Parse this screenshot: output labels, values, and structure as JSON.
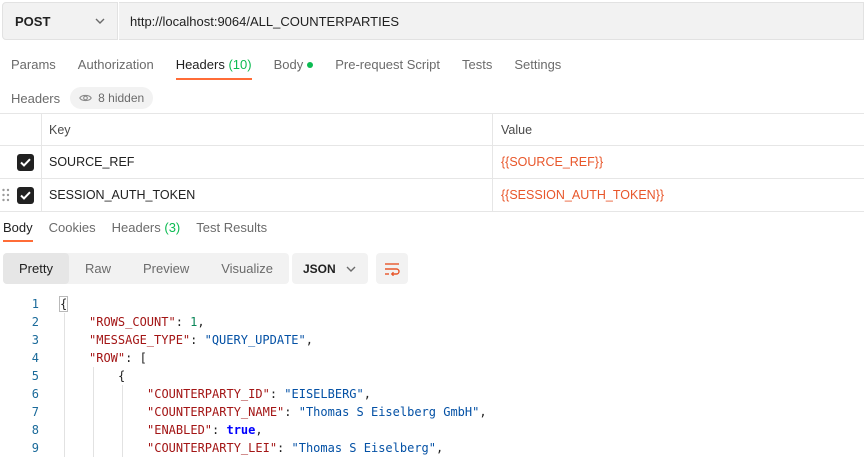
{
  "request": {
    "method": "POST",
    "url": "http://localhost:9064/ALL_COUNTERPARTIES"
  },
  "request_tabs": [
    {
      "label": "Params",
      "count": "",
      "dot": false,
      "active": false
    },
    {
      "label": "Authorization",
      "count": "",
      "dot": false,
      "active": false
    },
    {
      "label": "Headers",
      "count": "(10)",
      "dot": false,
      "active": true
    },
    {
      "label": "Body",
      "count": "",
      "dot": true,
      "active": false
    },
    {
      "label": "Pre-request Script",
      "count": "",
      "dot": false,
      "active": false
    },
    {
      "label": "Tests",
      "count": "",
      "dot": false,
      "active": false
    },
    {
      "label": "Settings",
      "count": "",
      "dot": false,
      "active": false
    }
  ],
  "headers_section": {
    "label": "Headers",
    "hidden_label": "8 hidden"
  },
  "headers_table": {
    "col_key": "Key",
    "col_value": "Value",
    "rows": [
      {
        "key": "SOURCE_REF",
        "value": "{{SOURCE_REF}}",
        "checked": true
      },
      {
        "key": "SESSION_AUTH_TOKEN",
        "value": "{{SESSION_AUTH_TOKEN}}",
        "checked": true
      }
    ]
  },
  "response_tabs": [
    {
      "label": "Body",
      "count": "",
      "active": true
    },
    {
      "label": "Cookies",
      "count": "",
      "active": false
    },
    {
      "label": "Headers",
      "count": "(3)",
      "active": false
    },
    {
      "label": "Test Results",
      "count": "",
      "active": false
    }
  ],
  "view_modes": [
    {
      "label": "Pretty",
      "active": true
    },
    {
      "label": "Raw",
      "active": false
    },
    {
      "label": "Preview",
      "active": false
    },
    {
      "label": "Visualize",
      "active": false
    }
  ],
  "format": {
    "selected": "JSON"
  },
  "code_lines": [
    {
      "num": "1",
      "indent": 0,
      "tokens": [
        {
          "t": "p",
          "v": "{"
        }
      ]
    },
    {
      "num": "2",
      "indent": 1,
      "tokens": [
        {
          "t": "k",
          "v": "\"ROWS_COUNT\""
        },
        {
          "t": "p",
          "v": ": "
        },
        {
          "t": "n",
          "v": "1"
        },
        {
          "t": "p",
          "v": ","
        }
      ]
    },
    {
      "num": "3",
      "indent": 1,
      "tokens": [
        {
          "t": "k",
          "v": "\"MESSAGE_TYPE\""
        },
        {
          "t": "p",
          "v": ": "
        },
        {
          "t": "s",
          "v": "\"QUERY_UPDATE\""
        },
        {
          "t": "p",
          "v": ","
        }
      ]
    },
    {
      "num": "4",
      "indent": 1,
      "tokens": [
        {
          "t": "k",
          "v": "\"ROW\""
        },
        {
          "t": "p",
          "v": ": ["
        }
      ]
    },
    {
      "num": "5",
      "indent": 2,
      "tokens": [
        {
          "t": "p",
          "v": "{"
        }
      ]
    },
    {
      "num": "6",
      "indent": 3,
      "tokens": [
        {
          "t": "k",
          "v": "\"COUNTERPARTY_ID\""
        },
        {
          "t": "p",
          "v": ": "
        },
        {
          "t": "s",
          "v": "\"EISELBERG\""
        },
        {
          "t": "p",
          "v": ","
        }
      ]
    },
    {
      "num": "7",
      "indent": 3,
      "tokens": [
        {
          "t": "k",
          "v": "\"COUNTERPARTY_NAME\""
        },
        {
          "t": "p",
          "v": ": "
        },
        {
          "t": "s",
          "v": "\"Thomas S Eiselberg GmbH\""
        },
        {
          "t": "p",
          "v": ","
        }
      ]
    },
    {
      "num": "8",
      "indent": 3,
      "tokens": [
        {
          "t": "k",
          "v": "\"ENABLED\""
        },
        {
          "t": "p",
          "v": ": "
        },
        {
          "t": "b",
          "v": "true"
        },
        {
          "t": "p",
          "v": ","
        }
      ]
    },
    {
      "num": "9",
      "indent": 3,
      "tokens": [
        {
          "t": "k",
          "v": "\"COUNTERPARTY_LEI\""
        },
        {
          "t": "p",
          "v": ": "
        },
        {
          "t": "s",
          "v": "\"Thomas S Eiselberg\""
        },
        {
          "t": "p",
          "v": ","
        }
      ]
    }
  ],
  "colors": {
    "accent": "#ff6c37",
    "count_green": "#0cbb52",
    "variable_orange": "#e8562a",
    "json_key": "#a31515",
    "json_string": "#0451a5",
    "json_number": "#098658",
    "json_boolean": "#0000ff"
  },
  "icons": {
    "method_dropdown": "chevron-down-icon",
    "hidden_headers": "eye-icon",
    "row_checkbox": "checkmark-icon",
    "row_drag": "drag-handle-icon",
    "format_dropdown": "chevron-down-icon",
    "wrap_lines": "wrap-lines-icon"
  }
}
